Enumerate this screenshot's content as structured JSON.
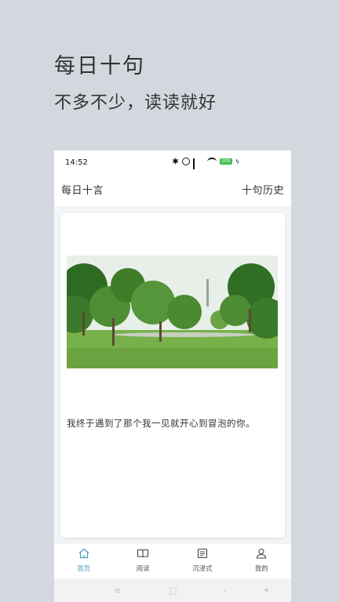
{
  "promo": {
    "title": "每日十句",
    "subtitle": "不多不少，读读就好"
  },
  "status_bar": {
    "time": "14:52",
    "battery": "100",
    "icons": [
      "bluetooth-icon",
      "alarm-icon",
      "signal-icon",
      "wifi-icon",
      "battery-icon",
      "charging-icon"
    ]
  },
  "header": {
    "title": "每日十言",
    "history_link": "十句历史"
  },
  "card": {
    "image": "photo of trees on a green lawn",
    "quote": "我终于遇到了那个我一见就开心到冒泡的你。"
  },
  "tabs": [
    {
      "label": "首页",
      "icon": "home-icon",
      "active": true
    },
    {
      "label": "阅读",
      "icon": "book-icon",
      "active": false
    },
    {
      "label": "沉浸式",
      "icon": "list-icon",
      "active": false
    },
    {
      "label": "我的",
      "icon": "user-icon",
      "active": false
    }
  ],
  "nav_bar": {
    "buttons": [
      "menu-icon",
      "home-square-icon",
      "back-icon",
      "accessibility-icon"
    ]
  },
  "colors": {
    "background": "#d3d8de",
    "accent": "#4aa0b8",
    "text": "#333333"
  }
}
